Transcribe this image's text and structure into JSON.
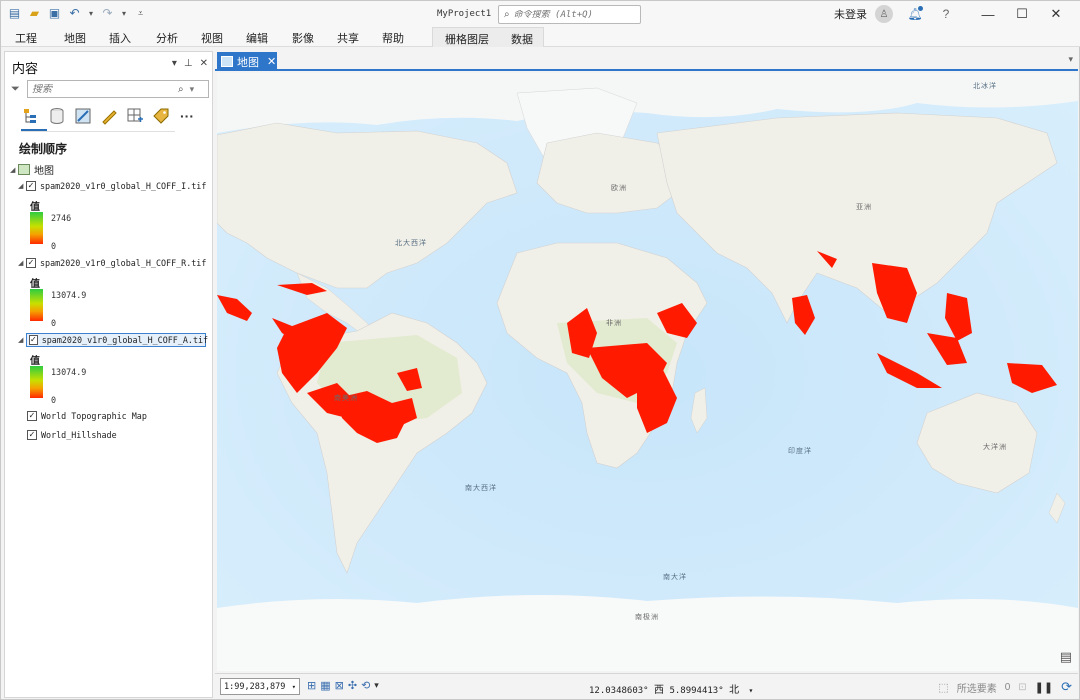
{
  "title_bar": {
    "project_name": "MyProject1",
    "command_search_placeholder": "命令搜索 (Alt+Q)",
    "sign_in_label": "未登录",
    "icons": [
      "new-project-icon",
      "open-project-icon",
      "save-icon",
      "undo-icon",
      "redo-icon",
      "customize-icon"
    ]
  },
  "ribbon": {
    "tabs": [
      "工程",
      "地图",
      "插入",
      "分析",
      "视图",
      "编辑",
      "影像",
      "共享",
      "帮助"
    ],
    "contextual_tabs": [
      "栅格图层",
      "数据"
    ]
  },
  "contents_pane": {
    "title": "内容",
    "search_placeholder": "搜索",
    "section_title": "绘制顺序",
    "map_name": "地图",
    "layers": [
      {
        "name": "spam2020_v1r0_global_H_COFF_I.tif",
        "checked": true,
        "value_label": "值",
        "max": "2746",
        "min": "0"
      },
      {
        "name": "spam2020_v1r0_global_H_COFF_R.tif",
        "checked": true,
        "value_label": "值",
        "max": "13074.9",
        "min": "0"
      },
      {
        "name": "spam2020_v1r0_global_H_COFF_A.tif",
        "checked": true,
        "selected": true,
        "value_label": "值",
        "max": "13074.9",
        "min": "0"
      }
    ],
    "basemaps": [
      {
        "name": "World Topographic Map",
        "checked": true
      },
      {
        "name": "World_Hillshade",
        "checked": true
      }
    ]
  },
  "map_view": {
    "tab_label": "地图",
    "labels": {
      "arctic": "北冰洋",
      "europe": "欧洲",
      "asia": "亚洲",
      "north_atlantic": "北大西洋",
      "africa": "非洲",
      "south_america": "南美洲",
      "indian_ocean": "印度洋",
      "oceania": "大洋洲",
      "south_atlantic": "南大西洋",
      "southern_ocean": "南大洋",
      "antarctica": "南极洲"
    },
    "colors": {
      "ocean": "#cde8fb",
      "land": "#f2f1ea",
      "green": "#dfe9c8",
      "coffee": "#ff1a00"
    }
  },
  "status_bar": {
    "scale": "1:99,283,879",
    "coords_lon": "12.0348603°",
    "coords_lon_dir": "西",
    "coords_lat": "5.8994413°",
    "coords_lat_dir": "北",
    "selected_features_label": "所选要素",
    "selected_count": "0"
  }
}
